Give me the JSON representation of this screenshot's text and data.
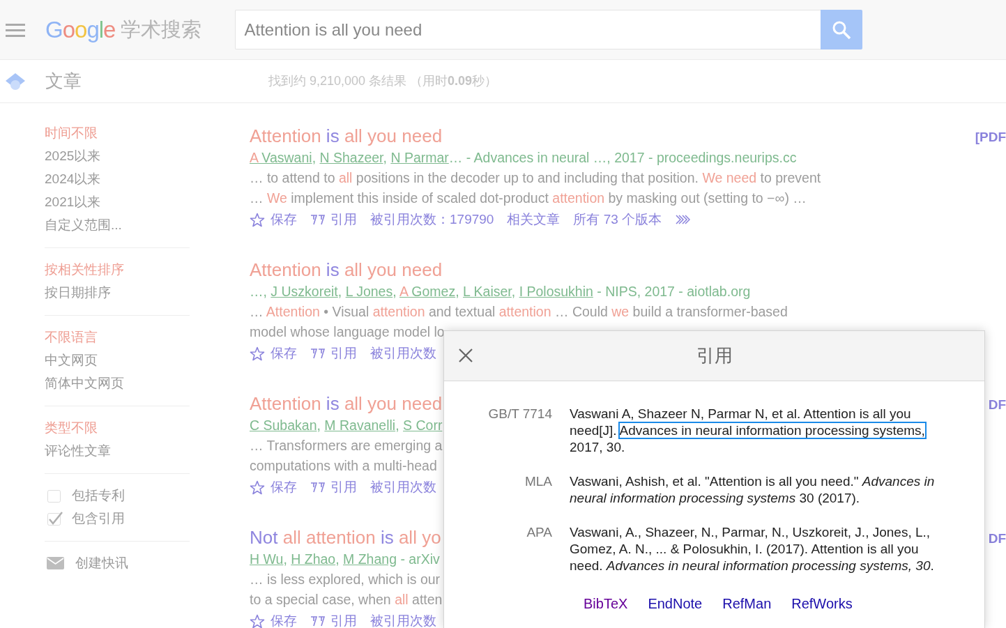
{
  "header": {
    "logo": "Google",
    "product": "学术搜索",
    "search": {
      "value": "Attention is all you need"
    }
  },
  "subheader": {
    "section": "文章",
    "stats": "找到约 9,210,000 条结果 （用时**0.09**秒）"
  },
  "sidebar": {
    "groups": [
      {
        "items": [
          {
            "kind": "link",
            "text": "时间不限",
            "selected": true
          },
          {
            "kind": "link",
            "text": "2025以来",
            "selected": false
          },
          {
            "kind": "link",
            "text": "2024以来",
            "selected": false
          },
          {
            "kind": "link",
            "text": "2021以来",
            "selected": false
          },
          {
            "kind": "link",
            "text": "自定义范围...",
            "selected": false
          }
        ]
      },
      {
        "items": [
          {
            "kind": "link",
            "text": "按相关性排序",
            "selected": true
          },
          {
            "kind": "link",
            "text": "按日期排序",
            "selected": false
          }
        ]
      },
      {
        "items": [
          {
            "kind": "link",
            "text": "不限语言",
            "selected": true
          },
          {
            "kind": "link",
            "text": "中文网页",
            "selected": false
          },
          {
            "kind": "link",
            "text": "简体中文网页",
            "selected": false
          }
        ]
      },
      {
        "items": [
          {
            "kind": "link",
            "text": "类型不限",
            "selected": true
          },
          {
            "kind": "link",
            "text": "评论性文章",
            "selected": false
          }
        ]
      },
      {
        "items": [
          {
            "kind": "checkbox",
            "text": "包括专利",
            "checked": false
          },
          {
            "kind": "checkbox",
            "text": "包含引用",
            "checked": true
          }
        ]
      },
      {
        "items": [
          {
            "kind": "alert",
            "text": "创建快讯"
          }
        ]
      }
    ]
  },
  "results": [
    {
      "title": [
        {
          "text": "Attention",
          "hit": true
        },
        {
          "text": " is ",
          "hit": false
        },
        {
          "text": "all you need",
          "hit": true
        }
      ],
      "pdf": "[PDF",
      "authors": [
        {
          "kind": "link",
          "parts": [
            {
              "text": "A",
              "hit": true
            },
            {
              "text": " Vaswani",
              "hit": false
            }
          ]
        },
        {
          "kind": "text",
          "text": ", "
        },
        {
          "kind": "link",
          "parts": [
            {
              "text": "N Shazeer",
              "hit": false
            }
          ]
        },
        {
          "kind": "text",
          "text": ", "
        },
        {
          "kind": "link",
          "parts": [
            {
              "text": "N Parmar",
              "hit": false
            }
          ]
        },
        {
          "kind": "text",
          "text": "… - Advances in neural …, 2017 - proceedings.neurips.cc"
        }
      ],
      "snippet": [
        [
          {
            "text": "… to attend to ",
            "hit": false
          },
          {
            "text": "all",
            "hit": true
          },
          {
            "text": " positions in the decoder up to and including that position. ",
            "hit": false
          },
          {
            "text": "We need",
            "hit": true
          },
          {
            "text": " to prevent",
            "hit": false
          }
        ],
        [
          {
            "text": "… ",
            "hit": false
          },
          {
            "text": "We",
            "hit": true
          },
          {
            "text": " implement this inside of scaled dot-product ",
            "hit": false
          },
          {
            "text": "attention",
            "hit": true
          },
          {
            "text": " by masking out (setting to −∞) …",
            "hit": false
          }
        ]
      ],
      "actions": [
        {
          "kind": "save",
          "text": "保存"
        },
        {
          "kind": "cite",
          "text": "引用"
        },
        {
          "kind": "citedby",
          "text": "被引用次数：179790"
        },
        {
          "kind": "related",
          "text": "相关文章"
        },
        {
          "kind": "versions",
          "text": "所有 73 个版本"
        },
        {
          "kind": "more"
        }
      ]
    },
    {
      "title": [
        {
          "text": "Attention",
          "hit": true
        },
        {
          "text": " is ",
          "hit": false
        },
        {
          "text": "all you need",
          "hit": true
        }
      ],
      "authors": [
        {
          "kind": "text",
          "text": "…, "
        },
        {
          "kind": "link",
          "parts": [
            {
              "text": "J Uszkoreit",
              "hit": false
            }
          ]
        },
        {
          "kind": "text",
          "text": ", "
        },
        {
          "kind": "link",
          "parts": [
            {
              "text": "L Jones",
              "hit": false
            }
          ]
        },
        {
          "kind": "text",
          "text": ", "
        },
        {
          "kind": "link",
          "parts": [
            {
              "text": "A",
              "hit": true
            },
            {
              "text": " Gomez",
              "hit": false
            }
          ]
        },
        {
          "kind": "text",
          "text": ", "
        },
        {
          "kind": "link",
          "parts": [
            {
              "text": "L Kaiser",
              "hit": false
            }
          ]
        },
        {
          "kind": "text",
          "text": ", "
        },
        {
          "kind": "link",
          "parts": [
            {
              "text": "I Polosukhin",
              "hit": false
            }
          ]
        },
        {
          "kind": "text",
          "text": " - NIPS, 2017 - aiotlab.org"
        }
      ],
      "snippet": [
        [
          {
            "text": "… ",
            "hit": false
          },
          {
            "text": "Attention",
            "hit": true
          },
          {
            "text": " • Visual ",
            "hit": false
          },
          {
            "text": "attention",
            "hit": true
          },
          {
            "text": " and textual ",
            "hit": false
          },
          {
            "text": "attention",
            "hit": true
          },
          {
            "text": " … Could ",
            "hit": false
          },
          {
            "text": "we",
            "hit": true
          },
          {
            "text": " build a transformer-based",
            "hit": false
          }
        ],
        [
          {
            "text": "model whose language model lo",
            "hit": false
          }
        ]
      ],
      "actions": [
        {
          "kind": "save",
          "text": "保存"
        },
        {
          "kind": "cite",
          "text": "引用"
        },
        {
          "kind": "citedby",
          "text": "被引用次数"
        }
      ]
    },
    {
      "title": [
        {
          "text": "Attention",
          "hit": true
        },
        {
          "text": " is ",
          "hit": false
        },
        {
          "text": "all you need",
          "hit": true
        }
      ],
      "pdf": "DF",
      "authors": [
        {
          "kind": "link",
          "parts": [
            {
              "text": "C Subakan",
              "hit": false
            }
          ]
        },
        {
          "kind": "text",
          "text": ", "
        },
        {
          "kind": "link",
          "parts": [
            {
              "text": "M Ravanelli",
              "hit": false
            }
          ]
        },
        {
          "kind": "text",
          "text": ", "
        },
        {
          "kind": "link",
          "parts": [
            {
              "text": "S Corr",
              "hit": false
            }
          ]
        }
      ],
      "snippet": [
        [
          {
            "text": "… Transformers are emerging a",
            "hit": false
          }
        ],
        [
          {
            "text": "computations with a multi-head",
            "hit": false
          }
        ]
      ],
      "actions": [
        {
          "kind": "save",
          "text": "保存"
        },
        {
          "kind": "cite",
          "text": "引用"
        },
        {
          "kind": "citedby",
          "text": "被引用次数"
        }
      ]
    },
    {
      "title": [
        {
          "text": "Not ",
          "hit": false
        },
        {
          "text": "all attention",
          "hit": true
        },
        {
          "text": " is ",
          "hit": false
        },
        {
          "text": "all yo",
          "hit": true
        }
      ],
      "pdf": "DF",
      "authors": [
        {
          "kind": "link",
          "parts": [
            {
              "text": "H Wu",
              "hit": false
            }
          ]
        },
        {
          "kind": "text",
          "text": ", "
        },
        {
          "kind": "link",
          "parts": [
            {
              "text": "H Zhao",
              "hit": false
            }
          ]
        },
        {
          "kind": "text",
          "text": ", "
        },
        {
          "kind": "link",
          "parts": [
            {
              "text": "M Zhang",
              "hit": false
            }
          ]
        },
        {
          "kind": "text",
          "text": " - arXiv"
        }
      ],
      "snippet": [
        [
          {
            "text": "… is less explored, which is our",
            "hit": false
          }
        ],
        [
          {
            "text": "to a special case, when ",
            "hit": false
          },
          {
            "text": "all",
            "hit": true
          },
          {
            "text": " atten",
            "hit": false
          }
        ]
      ],
      "actions": [
        {
          "kind": "save",
          "text": "保存"
        },
        {
          "kind": "cite",
          "text": "引用"
        },
        {
          "kind": "citedby",
          "text": "被引用次数"
        }
      ]
    }
  ],
  "cite_dialog": {
    "title": "引用",
    "citations": [
      {
        "style": "GB/T 7714",
        "parts": [
          {
            "text": "Vaswani A, Shazeer N, Parmar N, et al. Attention is all you need[J].",
            "italic": false,
            "focused": false
          },
          {
            "text": "Advances in neural information processing systems,",
            "italic": false,
            "focused": true
          },
          {
            "text": " 2017, 30.",
            "italic": false,
            "focused": false
          }
        ]
      },
      {
        "style": "MLA",
        "parts": [
          {
            "text": "Vaswani, Ashish, et al. \"Attention is all you need.\" ",
            "italic": false,
            "focused": false
          },
          {
            "text": "Advances in neural information processing systems",
            "italic": true,
            "focused": false
          },
          {
            "text": " 30 (2017).",
            "italic": false,
            "focused": false
          }
        ]
      },
      {
        "style": "APA",
        "parts": [
          {
            "text": "Vaswani, A., Shazeer, N., Parmar, N., Uszkoreit, J., Jones, L., Gomez, A. N., ... & Polosukhin, I. (2017). Attention is all you need. ",
            "italic": false,
            "focused": false
          },
          {
            "text": "Advances in neural information processing systems, 30",
            "italic": true,
            "focused": false
          },
          {
            "text": ".",
            "italic": false,
            "focused": false
          }
        ]
      }
    ],
    "exports": [
      {
        "text": "BibTeX",
        "visited": true
      },
      {
        "text": "EndNote",
        "visited": false
      },
      {
        "text": "RefMan",
        "visited": false
      },
      {
        "text": "RefWorks",
        "visited": false
      }
    ]
  }
}
